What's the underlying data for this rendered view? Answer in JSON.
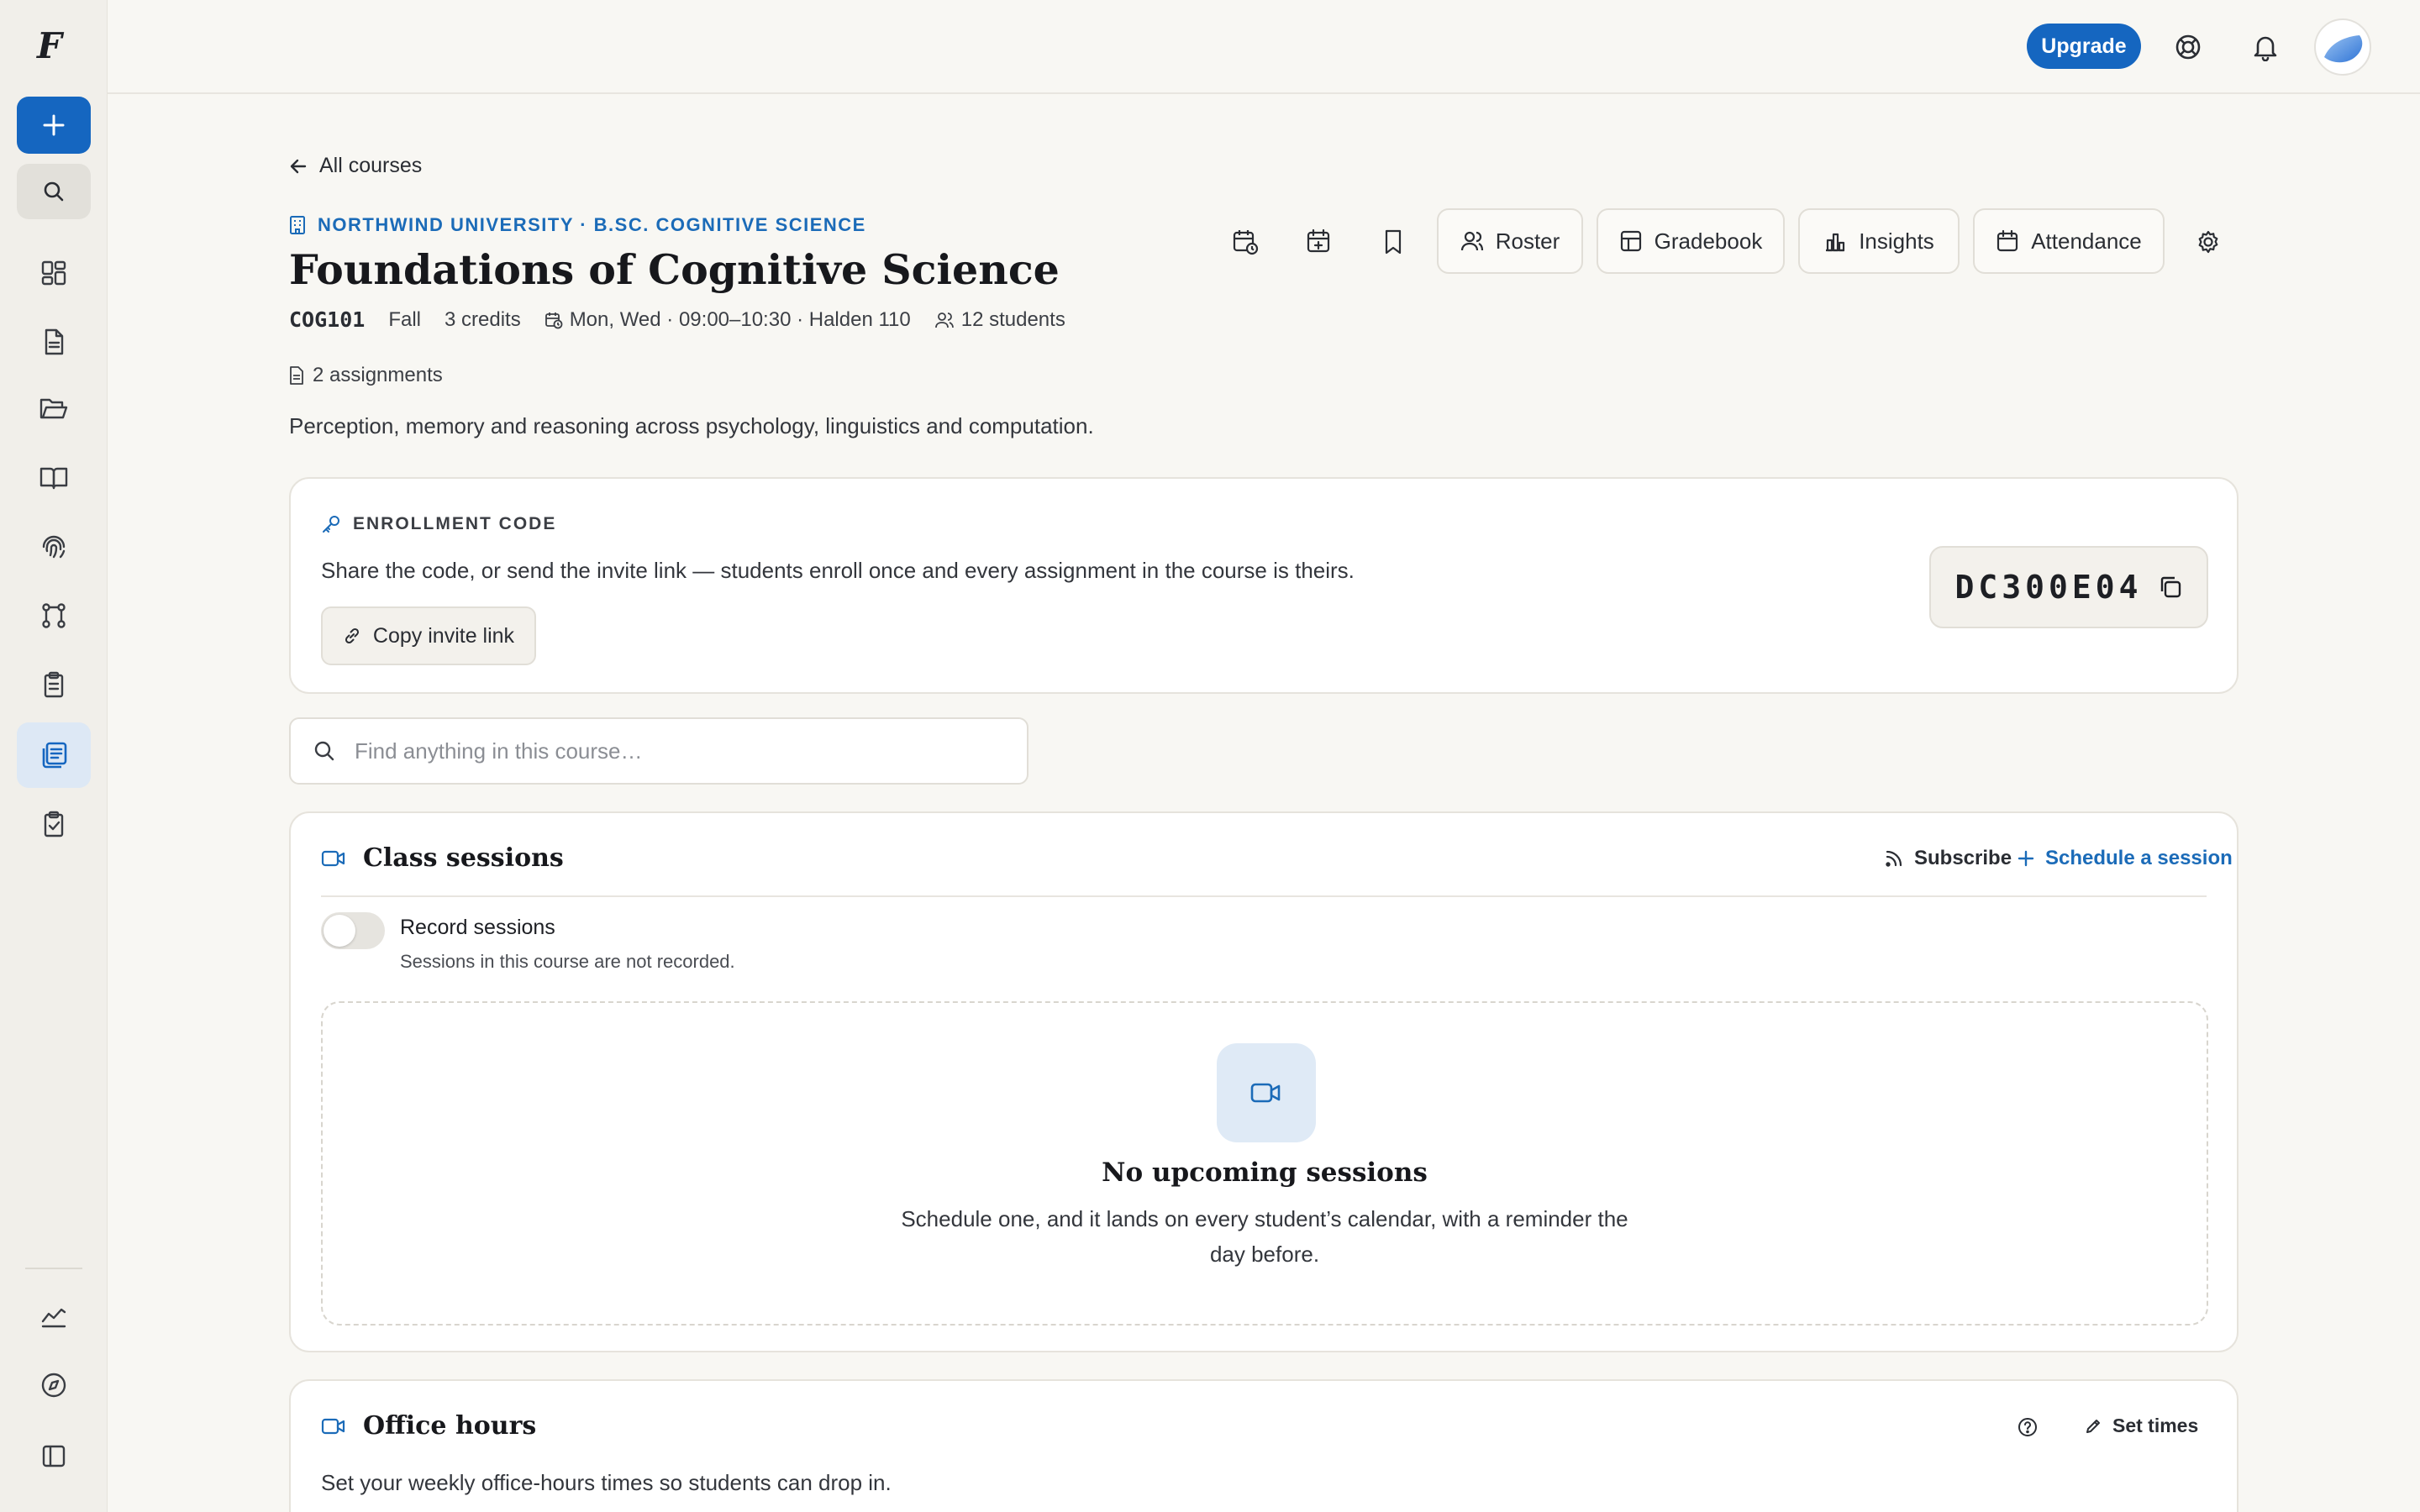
{
  "app": {
    "logo_letter": "F"
  },
  "sidebar": {
    "new_button": "new",
    "search_button": "search",
    "items": [
      {
        "icon": "dashboard-icon"
      },
      {
        "icon": "document-icon"
      },
      {
        "icon": "folder-icon"
      },
      {
        "icon": "book-icon"
      },
      {
        "icon": "fingerprint-icon"
      },
      {
        "icon": "workflow-icon"
      },
      {
        "icon": "clipboard-icon"
      },
      {
        "icon": "courses-icon",
        "active": true
      },
      {
        "icon": "clipboard-check-icon"
      }
    ],
    "bottom": [
      {
        "icon": "analytics-icon"
      },
      {
        "icon": "compass-icon"
      },
      {
        "icon": "sidebar-toggle-icon"
      }
    ]
  },
  "topbar": {
    "upgrade_label": "Upgrade",
    "help_icon": "lifebuoy-icon",
    "notifications_icon": "bell-icon"
  },
  "course": {
    "back_label": "All courses",
    "org": "NORTHWIND UNIVERSITY · B.SC. COGNITIVE SCIENCE",
    "title": "Foundations of Cognitive Science",
    "code": "COG101",
    "term": "Fall",
    "credits": "3 credits",
    "schedule": "Mon, Wed · 09:00–10:30 · Halden 110",
    "students": "12 students",
    "assignments": "2 assignments",
    "description": "Perception, memory and reasoning across psychology, linguistics and computation."
  },
  "actions": {
    "roster": "Roster",
    "gradebook": "Gradebook",
    "insights": "Insights",
    "attendance": "Attendance"
  },
  "enrollment": {
    "label": "ENROLLMENT CODE",
    "text": "Share the code, or send the invite link — students enroll once and every assignment in the course is theirs.",
    "copy_link_label": "Copy invite link",
    "code": "DC300E04"
  },
  "search": {
    "placeholder": "Find anything in this course…"
  },
  "sessions": {
    "title": "Class sessions",
    "subscribe_label": "Subscribe",
    "schedule_label": "Schedule a session",
    "record_title": "Record sessions",
    "record_sub": "Sessions in this course are not recorded.",
    "record_enabled": false,
    "empty_title": "No upcoming sessions",
    "empty_text": "Schedule one, and it lands on every student’s calendar, with a reminder the day before."
  },
  "office_hours": {
    "title": "Office hours",
    "set_times_label": "Set times",
    "text": "Set your weekly office-hours times so students can drop in."
  },
  "colors": {
    "accent": "#1566c0",
    "link": "#1b6bb8",
    "background": "#f8f7f3"
  }
}
